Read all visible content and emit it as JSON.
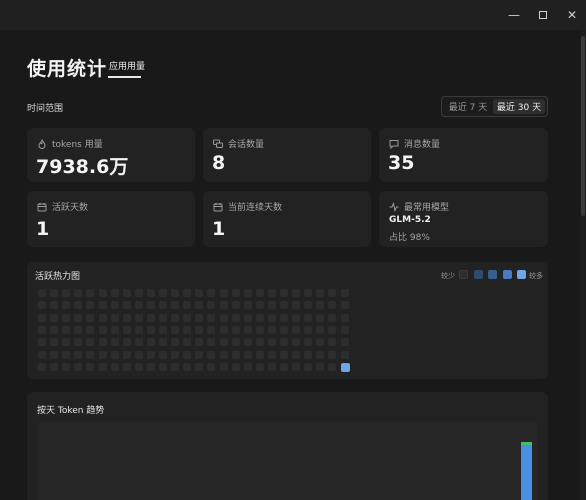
{
  "window": {
    "minimize_glyph": "—",
    "close_glyph": "✕"
  },
  "header": {
    "title": "使用统计",
    "tab": "应用用量"
  },
  "time_range": {
    "label": "时间范围",
    "options": [
      "最近 7 天",
      "最近 30 天"
    ],
    "selected": "最近 30 天"
  },
  "stats": {
    "tokens": {
      "label": "tokens 用量",
      "value": "7938.6万",
      "icon": "flame-icon"
    },
    "sessions": {
      "label": "会话数量",
      "value": "8",
      "icon": "chat-icon"
    },
    "messages": {
      "label": "消息数量",
      "value": "35",
      "icon": "message-icon"
    },
    "active_days": {
      "label": "活跃天数",
      "value": "1",
      "icon": "calendar-icon"
    },
    "streak": {
      "label": "当前连续天数",
      "value": "1",
      "icon": "calendar-icon"
    },
    "top_model": {
      "label": "最常用模型",
      "name": "GLM-5.2",
      "share": "占比 98%",
      "icon": "activity-icon"
    }
  },
  "heatmap": {
    "title": "活跃热力图",
    "legend_less": "较少",
    "legend_more": "较多",
    "legend_colors": [
      "#2d2d2d",
      "#2f4a6e",
      "#3a5f93",
      "#4a7bc0",
      "#6ea6e8"
    ],
    "weeks": 26,
    "days": 7,
    "active_cells": [
      {
        "week": 25,
        "day": 6,
        "level": 4
      }
    ],
    "empty_color": "#2d2d2d"
  },
  "trend": {
    "title": "按天 Token 趋势",
    "bar_color": "#4a8fe3",
    "cap_color": "#3fbf6c",
    "days": 30,
    "active_day_index": 29,
    "active_share_of_max": 1.0
  }
}
